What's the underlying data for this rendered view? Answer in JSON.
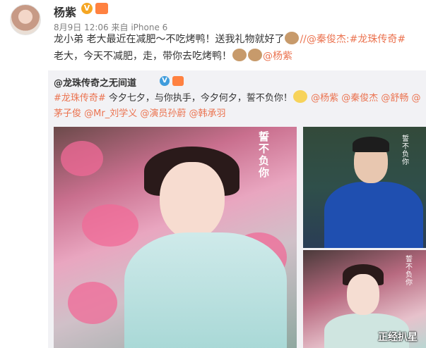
{
  "author": {
    "name": "杨紫",
    "badge_v": "V"
  },
  "post": {
    "date": "8月9日 12:06",
    "source": "来自 iPhone 6",
    "text_part1": "龙小弟 老大最近在减肥～不吃烤鸭！送我礼物就好了",
    "mention_qin_a": "//@秦俊杰:",
    "topic_a": "#龙珠传奇#",
    "text_part2": "老大，今天不减肥，走，带你去吃烤鸭！",
    "mention_yang": "@杨紫"
  },
  "repost": {
    "author": "@龙珠传奇之无间道",
    "badge_v": "V",
    "topic": "#龙珠传奇#",
    "text": " 今夕七夕，与你执手，今夕何夕，誓不负你！",
    "mentions": [
      "@杨紫",
      "@秦俊杰",
      "@舒畅",
      "@茅子俊",
      "@Mr_刘学义",
      "@演员孙蔚",
      "@韩承羽"
    ]
  },
  "images": {
    "main_vertical_text": "誓不负你",
    "top_vertical_text": "誓不负你",
    "bottom_vertical_text": "誓不负你"
  },
  "watermark": "正经扒星",
  "colors": {
    "link": "#eb7350",
    "repost_bg": "#f2f2f5",
    "vip_orange": "#ff8140"
  }
}
